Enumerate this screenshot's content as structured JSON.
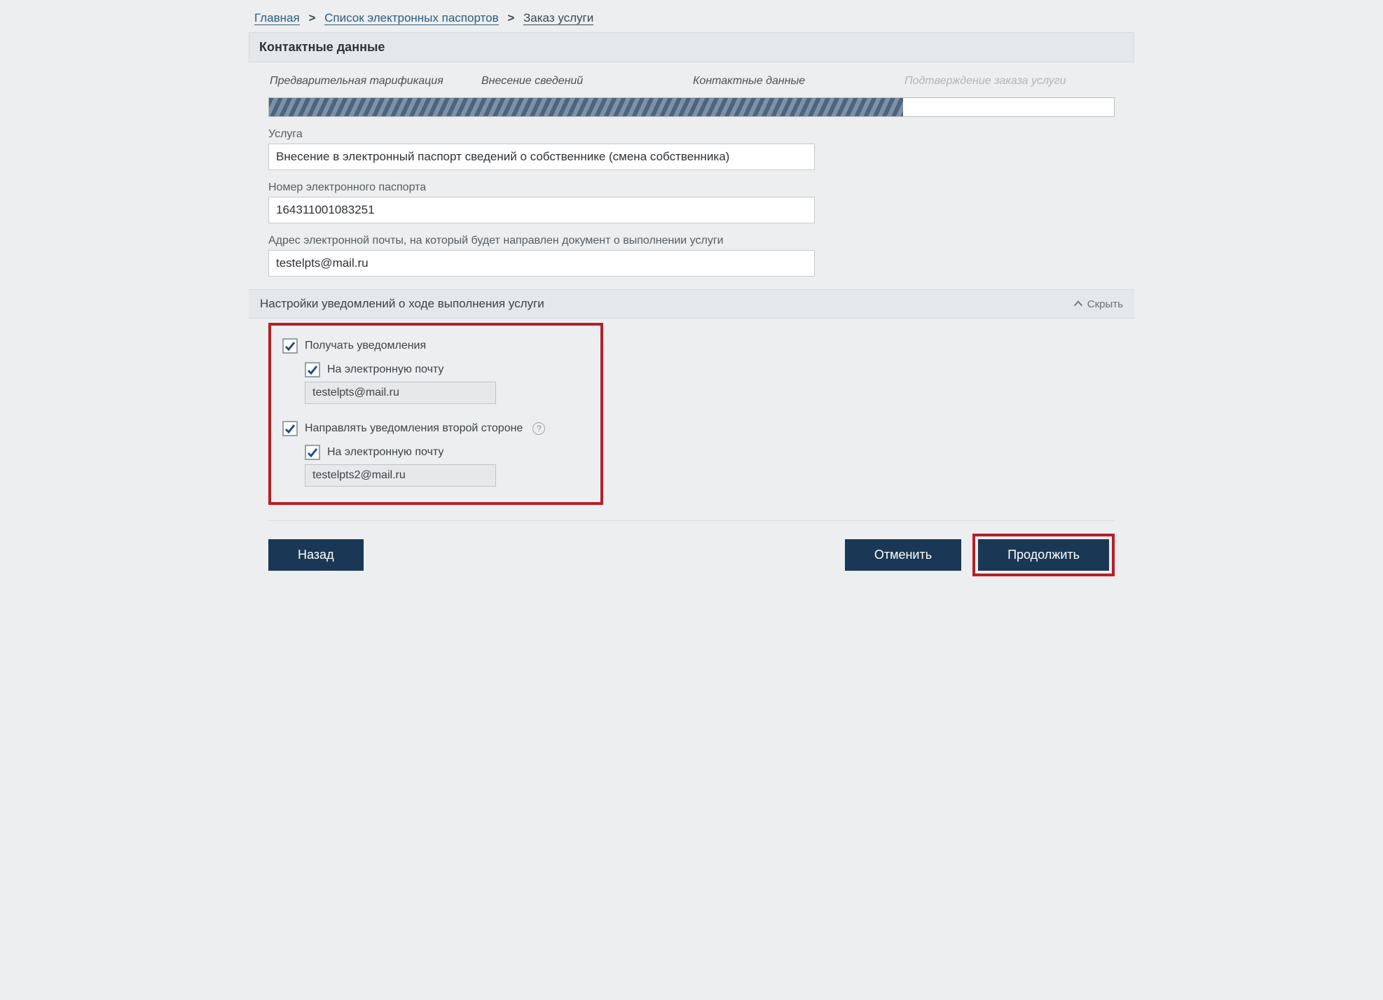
{
  "breadcrumb": {
    "home": "Главная",
    "list": "Список электронных паспортов",
    "current": "Заказ услуги"
  },
  "section_title": "Контактные данные",
  "steps": {
    "s1": "Предварительная тарификация",
    "s2": "Внесение сведений",
    "s3": "Контактные данные",
    "s4": "Подтверждение заказа услуги"
  },
  "progress_percent": 75,
  "fields": {
    "service_label": "Услуга",
    "service_value": "Внесение в электронный паспорт сведений о собственнике (смена собственника)",
    "passport_label": "Номер электронного паспорта",
    "passport_value": "164311001083251",
    "email_label": "Адрес электронной почты, на который будет направлен документ о выполнении услуги",
    "email_value": "testelpts@mail.ru"
  },
  "notifications": {
    "header": "Настройки уведомлений о ходе выполнения услуги",
    "toggle_label": "Скрыть",
    "receive_label": "Получать уведомления",
    "by_email_label": "На электронную почту",
    "email1": "testelpts@mail.ru",
    "second_party_label": "Направлять уведомления второй стороне",
    "email2": "testelpts2@mail.ru"
  },
  "buttons": {
    "back": "Назад",
    "cancel": "Отменить",
    "continue": "Продолжить"
  }
}
